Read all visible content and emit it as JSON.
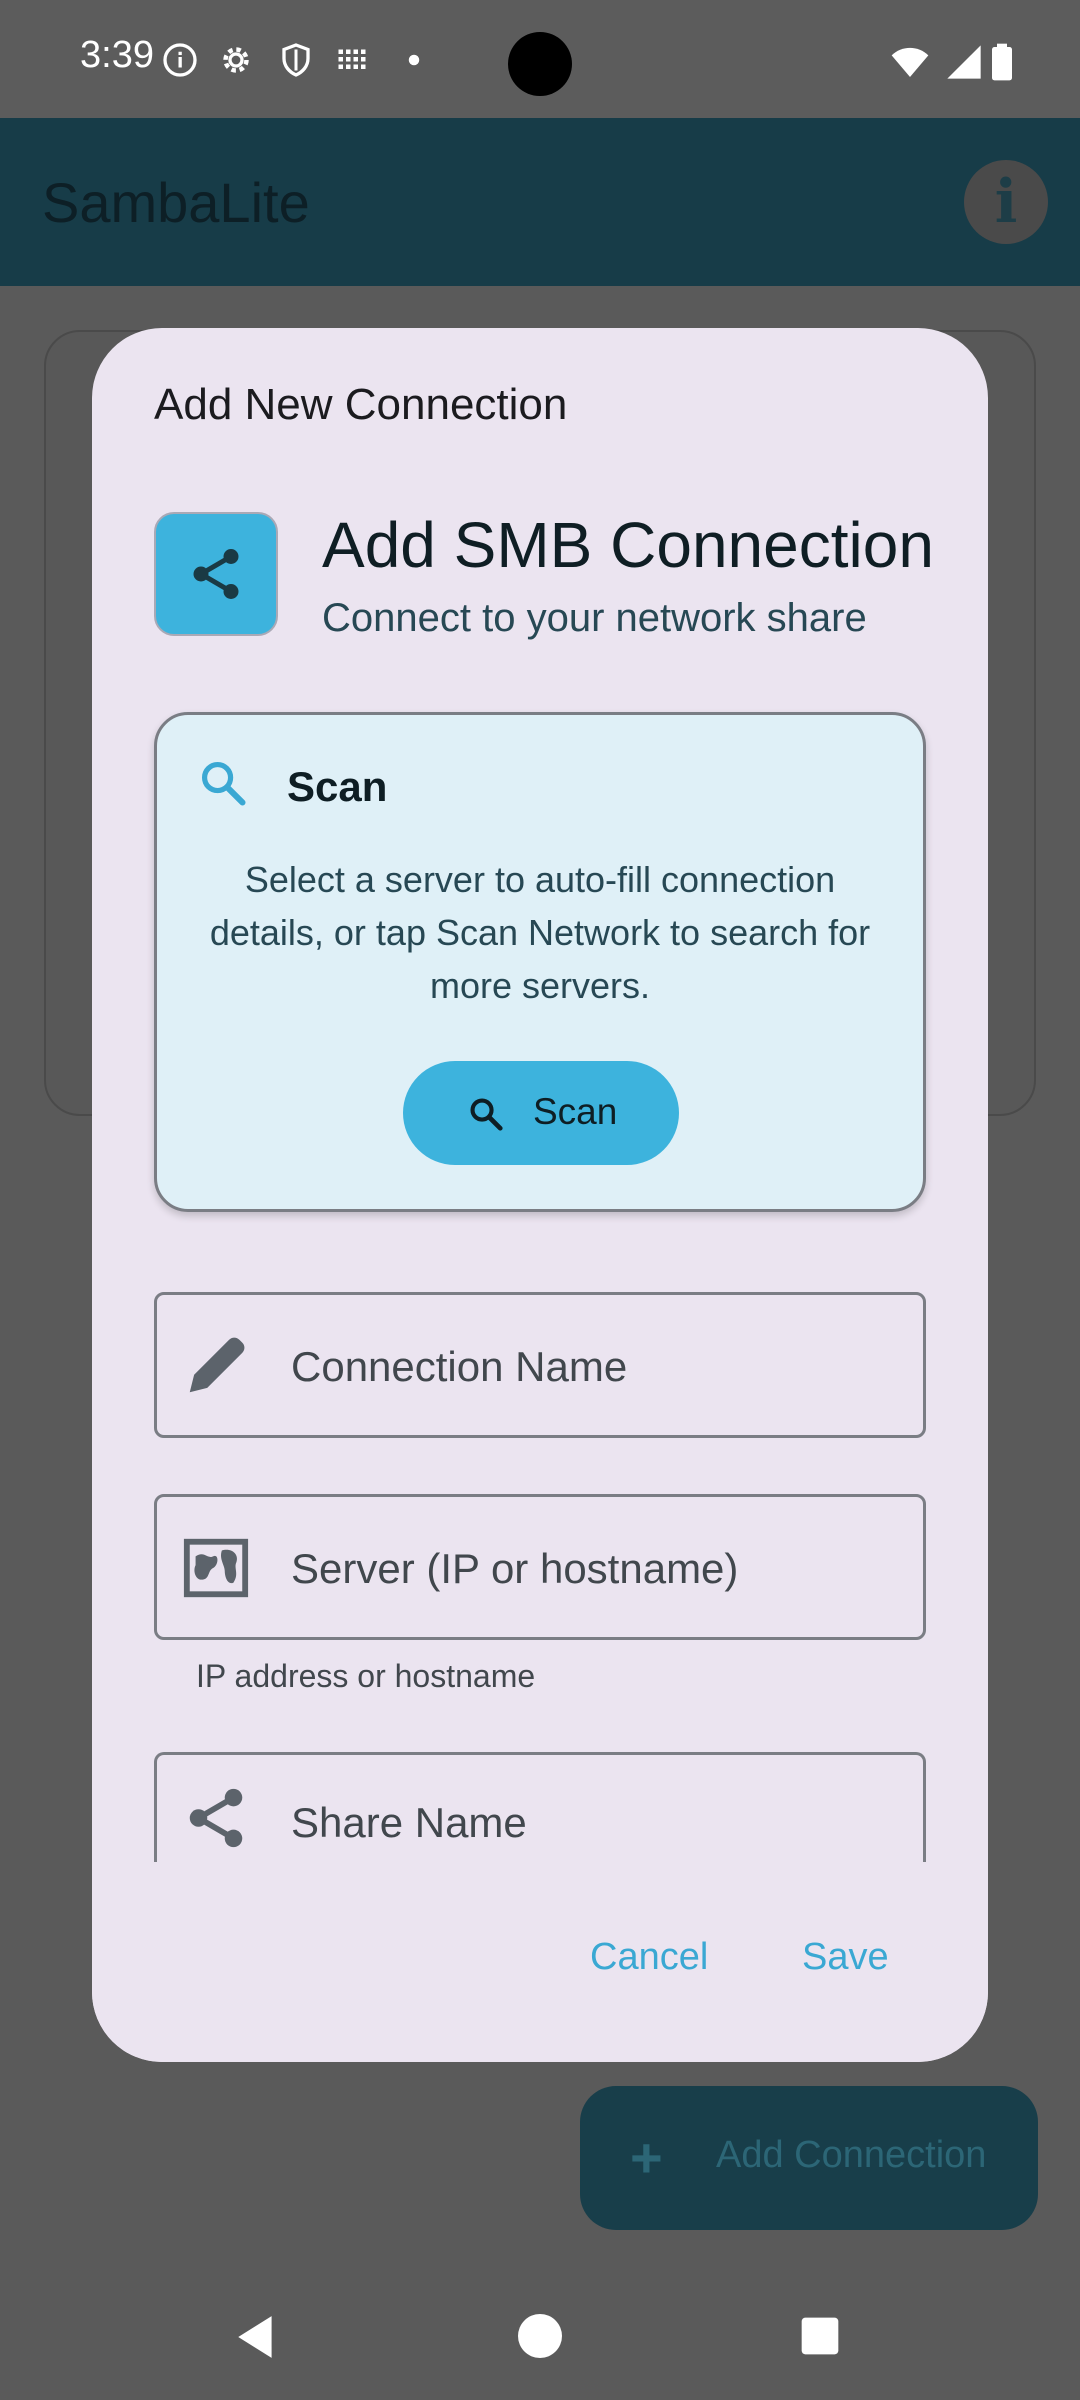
{
  "status_bar": {
    "time": "3:39",
    "icons": [
      "info-icon",
      "settings-gear-icon",
      "shield-icon",
      "grid-icon",
      "dot-icon",
      "wifi-icon",
      "signal-icon",
      "battery-icon"
    ]
  },
  "app_bar": {
    "title": "SambaLite",
    "info_icon": "info-icon"
  },
  "fab": {
    "plus": "+",
    "label": "Add Connection"
  },
  "dialog": {
    "title": "Add New Connection",
    "header": {
      "icon": "share-icon",
      "title": "Add SMB Connection",
      "subtitle": "Connect to your network share"
    },
    "scan_card": {
      "title": "Scan",
      "description": "Select a server to auto-fill connection details, or tap Scan Network to search for more servers.",
      "button_label": "Scan"
    },
    "fields": {
      "connection_name": {
        "placeholder": "Connection Name",
        "icon": "pencil-icon"
      },
      "server": {
        "placeholder": "Server (IP or hostname)",
        "icon": "network-map-icon",
        "helper": "IP address or hostname"
      },
      "share_name": {
        "placeholder": "Share Name",
        "icon": "share-icon"
      }
    },
    "actions": {
      "cancel": "Cancel",
      "save": "Save"
    }
  },
  "colors": {
    "accent": "#3db3dd",
    "app_bar": "#173c48",
    "dialog_bg": "#ebe4f0",
    "scan_card_bg": "#dff0f7",
    "scrim": "#5a5a5a"
  }
}
